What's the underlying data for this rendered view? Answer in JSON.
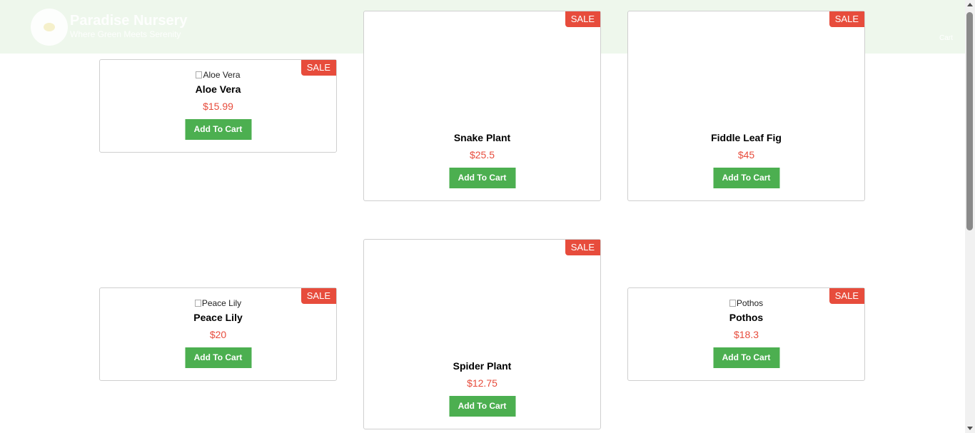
{
  "header": {
    "brand_title": "Paradise Nursery",
    "brand_tagline": "Where Green Meets Serenity",
    "nav_link": "Cart"
  },
  "sale_label": "SALE",
  "add_to_cart_label": "Add To Cart",
  "products": [
    {
      "name": "Aloe Vera",
      "price": "$15.99",
      "image_alt": "Aloe Vera"
    },
    {
      "name": "Snake Plant",
      "price": "$25.5",
      "image_alt": ""
    },
    {
      "name": "Fiddle Leaf Fig",
      "price": "$45",
      "image_alt": ""
    },
    {
      "name": "Peace Lily",
      "price": "$20",
      "image_alt": "Peace Lily"
    },
    {
      "name": "Spider Plant",
      "price": "$12.75",
      "image_alt": ""
    },
    {
      "name": "Pothos",
      "price": "$18.3",
      "image_alt": "Pothos"
    }
  ],
  "colors": {
    "accent_green": "#4caf50",
    "sale_red": "#e74c3c",
    "header_bg": "#eef7ec"
  }
}
